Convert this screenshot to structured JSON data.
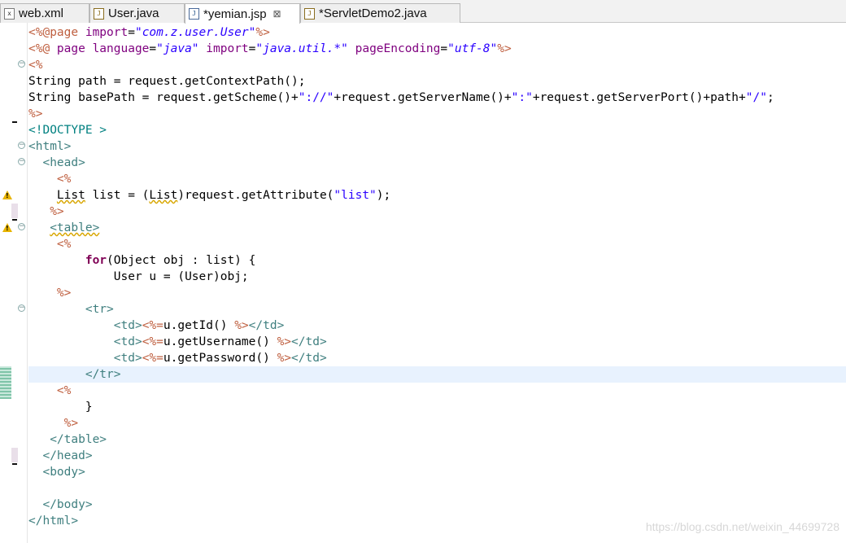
{
  "tabs": [
    {
      "label": "web.xml",
      "icon": "xml-file-icon",
      "active": false
    },
    {
      "label": "User.java",
      "icon": "java-file-icon",
      "active": false
    },
    {
      "label": "*yemian.jsp",
      "icon": "jsp-file-icon",
      "active": true,
      "close": "⊠"
    },
    {
      "label": "*ServletDemo2.java",
      "icon": "java-file-icon",
      "active": false
    }
  ],
  "code": {
    "l1": {
      "a": "<%@page ",
      "b": "import",
      "c": "=",
      "d": "\"com.z.user.User\"",
      "e": "%>"
    },
    "l2": {
      "a": "<%@ ",
      "b": "page ",
      "c": "language",
      "d": "=",
      "e": "\"java\"",
      "f": " import",
      "g": "=",
      "h": "\"java.util.*\"",
      "i": " pageEncoding",
      "j": "=",
      "k": "\"utf-8\"",
      "l": "%>"
    },
    "l3": {
      "a": "<%"
    },
    "l4": {
      "a": "String path = request.getContextPath();"
    },
    "l5": {
      "a": "String basePath = request.getScheme()+",
      "b": "\"://\"",
      "c": "+request.getServerName()+",
      "d": "\":\"",
      "e": "+request.getServerPort()+path+",
      "f": "\"/\"",
      "g": ";"
    },
    "l6": {
      "a": "%>"
    },
    "l7": {
      "a": "<!DOCTYPE >"
    },
    "l8": {
      "a": "<html>"
    },
    "l9": {
      "indent": "  ",
      "a": "<head>"
    },
    "l10": {
      "indent": "    ",
      "a": "<%"
    },
    "l11": {
      "indent": "    ",
      "a": "List",
      "b": " list = (",
      "c": "List",
      "d": ")request.getAttribute(",
      "e": "\"list\"",
      "f": ");"
    },
    "l12": {
      "indent": "   ",
      "a": "%>"
    },
    "l13": {
      "indent": "   ",
      "a": "<table>"
    },
    "l14": {
      "indent": "    ",
      "a": "<%"
    },
    "l15": {
      "indent": "        ",
      "a": "for",
      "b": "(Object obj : list) {"
    },
    "l16": {
      "indent": "            ",
      "a": "User u = (User)obj;"
    },
    "l17": {
      "indent": "    ",
      "a": "%>"
    },
    "l18": {
      "indent": "        ",
      "a": "<tr>"
    },
    "l19": {
      "indent": "            ",
      "a": "<td>",
      "b": "<%=",
      "c": "u.getId() ",
      "d": "%>",
      "e": "</td>"
    },
    "l20": {
      "indent": "            ",
      "a": "<td>",
      "b": "<%=",
      "c": "u.getUsername() ",
      "d": "%>",
      "e": "</td>"
    },
    "l21": {
      "indent": "            ",
      "a": "<td>",
      "b": "<%=",
      "c": "u.getPassword() ",
      "d": "%>",
      "e": "</td>"
    },
    "l22": {
      "indent": "        ",
      "a": "</tr>"
    },
    "l23": {
      "indent": "    ",
      "a": "<%"
    },
    "l24": {
      "indent": "        ",
      "a": "}"
    },
    "l25": {
      "indent": "     ",
      "a": "%>"
    },
    "l26": {
      "indent": "   ",
      "a": "</table>"
    },
    "l27": {
      "indent": "  ",
      "a": "</head>"
    },
    "l28": {
      "indent": "  ",
      "a": "<body>"
    },
    "l29": {
      "indent": "",
      "a": ""
    },
    "l30": {
      "indent": "  ",
      "a": "</body>"
    },
    "l31": {
      "a": "</html>"
    }
  },
  "gutter": {
    "fold_glyph": "−",
    "warn_glyph": "!"
  },
  "watermark": "https://blog.csdn.net/weixin_44699728",
  "colors": {
    "tag": "#3f7f7f",
    "jsp": "#bf5f3f",
    "attr": "#7f007f",
    "string": "#2a00ff",
    "keyword": "#7f0055",
    "current_line": "#e8f2fe"
  }
}
